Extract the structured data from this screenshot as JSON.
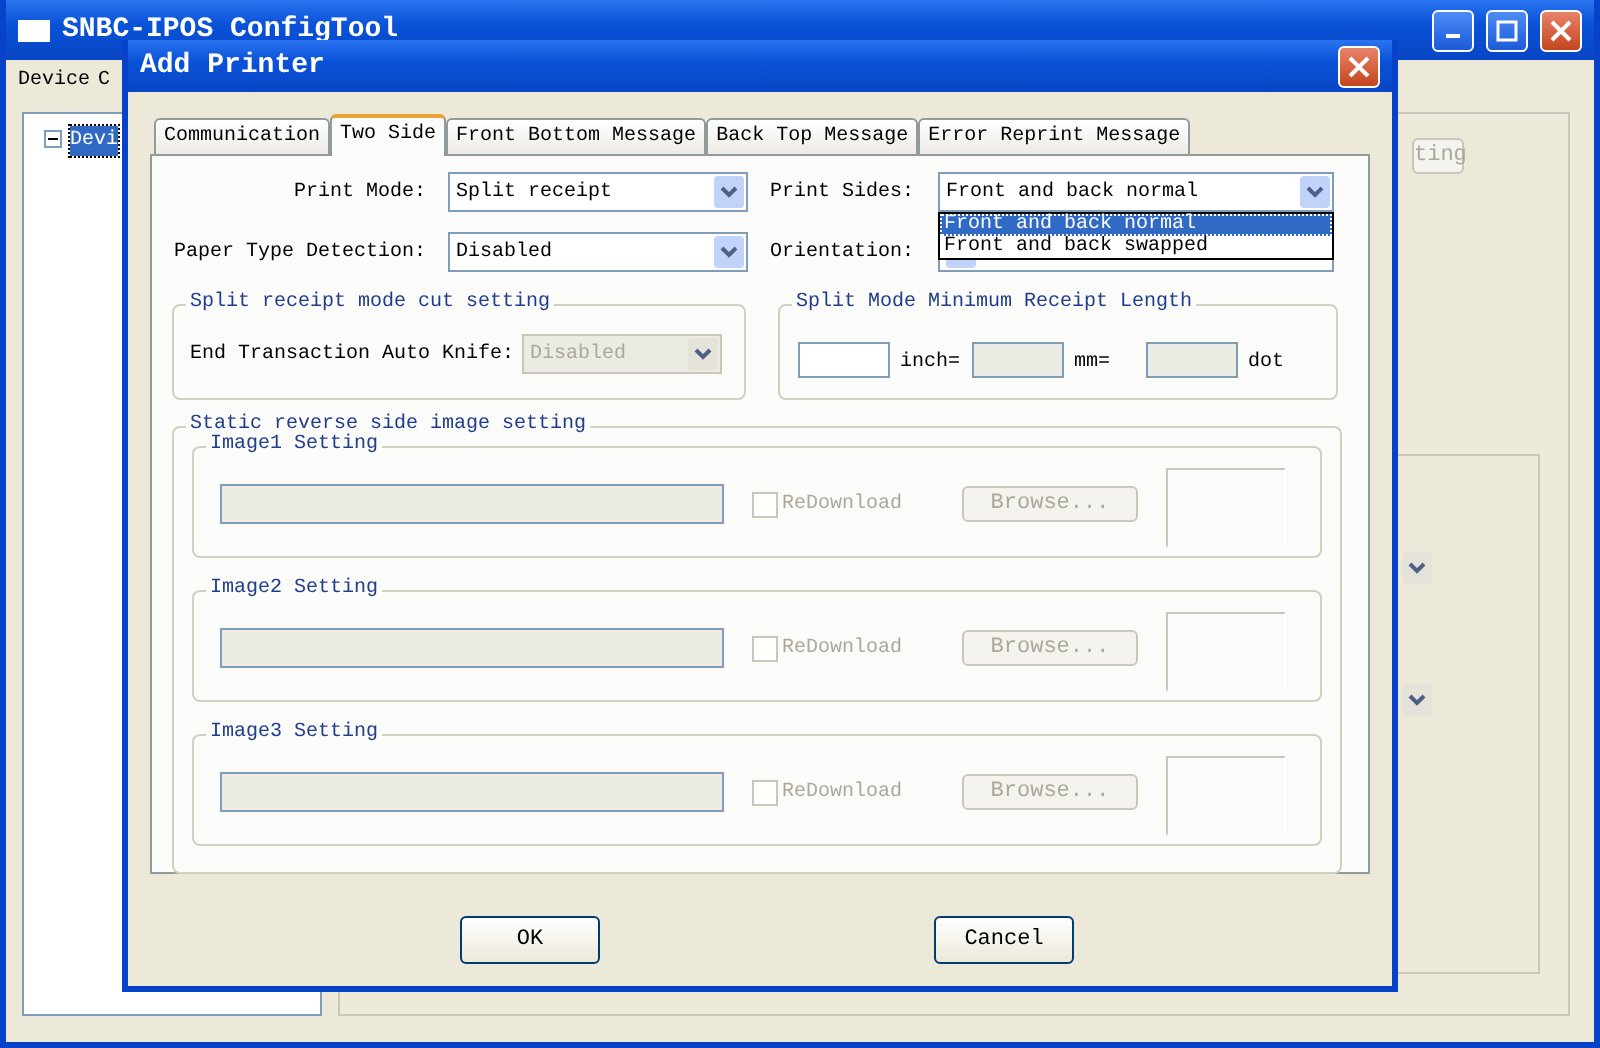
{
  "main_window": {
    "title": "SNBC-IPOS ConfigTool",
    "menu": [
      {
        "label": "Device"
      },
      {
        "label": "C"
      }
    ],
    "tree": [
      {
        "label": "Devi",
        "expanded": true,
        "selected": true
      }
    ],
    "button_fragment": "ting"
  },
  "dialog": {
    "title": "Add Printer",
    "tabs": [
      {
        "label": "Communication",
        "selected": false
      },
      {
        "label": "Two Side",
        "selected": true
      },
      {
        "label": "Front Bottom Message",
        "selected": false
      },
      {
        "label": "Back Top Message",
        "selected": false
      },
      {
        "label": "Error Reprint Message",
        "selected": false
      }
    ],
    "print_mode": {
      "label": "Print Mode:",
      "value": "Split receipt"
    },
    "print_sides": {
      "label": "Print Sides:",
      "value": "Front and back normal",
      "open": true,
      "options": [
        {
          "label": "Front and back normal",
          "selected": true
        },
        {
          "label": "Front and back swapped",
          "selected": false
        }
      ]
    },
    "paper_type_detection": {
      "label": "Paper Type Detection:",
      "value": "Disabled"
    },
    "orientation": {
      "label": "Orientation:"
    },
    "cut_setting": {
      "title": "Split receipt mode cut setting",
      "label": "End Transaction Auto Knife:",
      "value": "Disabled",
      "disabled": true
    },
    "min_length": {
      "title": "Split Mode Minimum Receipt Length",
      "units": [
        "inch=",
        "mm=",
        "dot"
      ],
      "disabled": [
        false,
        true,
        true
      ]
    },
    "image_settings": {
      "title": "Static reverse side image setting",
      "groups": [
        {
          "title": "Image1 Setting",
          "checkbox": "ReDownload",
          "checked": false,
          "button": "Browse...",
          "disabled": true
        },
        {
          "title": "Image2 Setting",
          "checkbox": "ReDownload",
          "checked": false,
          "button": "Browse...",
          "disabled": true
        },
        {
          "title": "Image3 Setting",
          "checkbox": "ReDownload",
          "checked": false,
          "button": "Browse...",
          "disabled": true
        }
      ]
    },
    "buttons": [
      "OK",
      "Cancel"
    ]
  }
}
